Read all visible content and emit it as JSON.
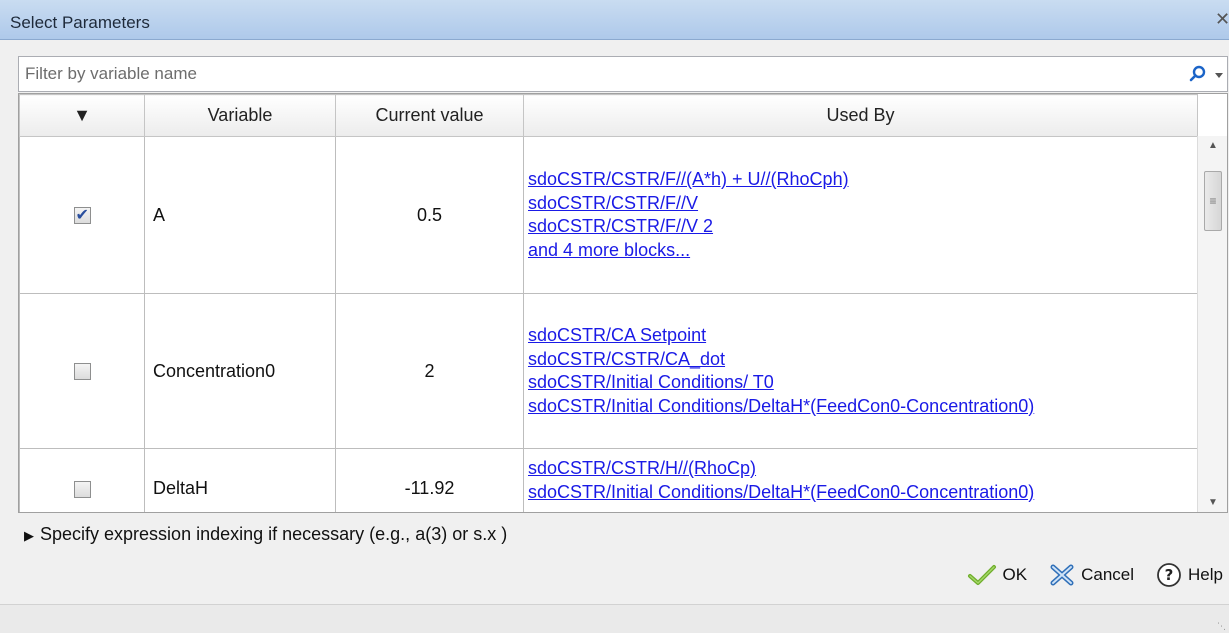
{
  "window": {
    "title": "Select Parameters",
    "close_glyph": "✕"
  },
  "filter": {
    "placeholder": "Filter by variable name",
    "value": ""
  },
  "table": {
    "headers": {
      "select": "▼",
      "variable": "Variable",
      "current_value": "Current value",
      "used_by": "Used By"
    },
    "rows": [
      {
        "checked": true,
        "variable": "A",
        "value": "0.5",
        "used_by": [
          "sdoCSTR/CSTR/F//(A*h) + U//(RhoCph)",
          "sdoCSTR/CSTR/F//V",
          "sdoCSTR/CSTR/F//V 2",
          "and 4 more blocks..."
        ]
      },
      {
        "checked": false,
        "variable": "Concentration0",
        "value": "2",
        "used_by": [
          "sdoCSTR/CA Setpoint",
          "sdoCSTR/CSTR/CA_dot",
          "sdoCSTR/Initial Conditions/ T0",
          "sdoCSTR/Initial Conditions/DeltaH*(FeedCon0-Concentration0)"
        ]
      },
      {
        "checked": false,
        "variable": "DeltaH",
        "value": "-11.92",
        "used_by": [
          "sdoCSTR/CSTR/H//(RhoCp)",
          "sdoCSTR/Initial Conditions/DeltaH*(FeedCon0-Concentration0)"
        ]
      }
    ]
  },
  "expression_indexing": {
    "label": "Specify expression indexing if necessary (e.g., a(3) or s.x )"
  },
  "buttons": {
    "ok": "OK",
    "cancel": "Cancel",
    "help": "Help"
  },
  "icons": {
    "search": "search-icon",
    "ok": "checkmark-icon",
    "cancel": "cancel-x-icon",
    "help": "help-icon"
  }
}
